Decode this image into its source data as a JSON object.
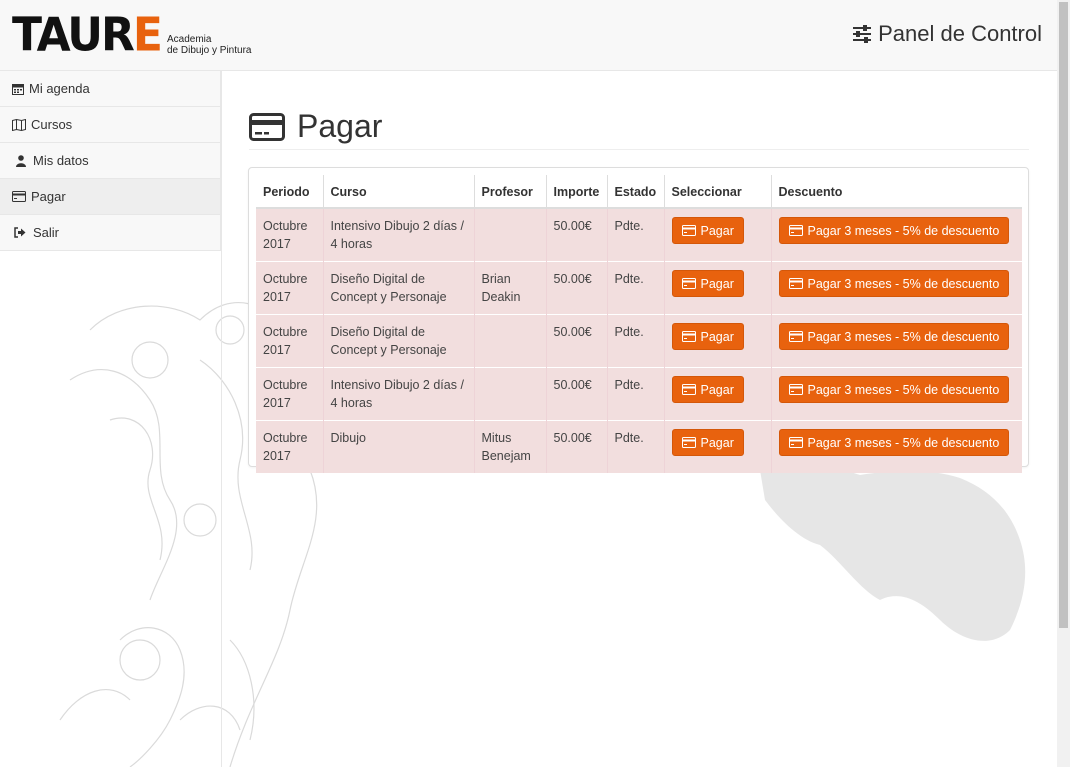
{
  "header": {
    "logo_main": "TAUR",
    "logo_accent": "E",
    "logo_sub_line1": "Academia",
    "logo_sub_line2": "de Dibujo y Pintura",
    "panel_label": "Panel de Control"
  },
  "sidebar": {
    "items": [
      {
        "label": "Mi agenda",
        "icon": "calendar-icon"
      },
      {
        "label": "Cursos",
        "icon": "map-icon"
      },
      {
        "label": "Mis datos",
        "icon": "user-icon"
      },
      {
        "label": "Pagar",
        "icon": "credit-card-icon"
      },
      {
        "label": "Salir",
        "icon": "sign-out-icon"
      }
    ]
  },
  "page": {
    "title": "Pagar",
    "title_icon": "credit-card-icon"
  },
  "table": {
    "headers": [
      "Periodo",
      "Curso",
      "Profesor",
      "Importe",
      "Estado",
      "Seleccionar",
      "Descuento"
    ],
    "pay_label": "Pagar",
    "discount_label": "Pagar 3 meses - 5% de descuento",
    "rows": [
      {
        "periodo": "Octubre 2017",
        "curso": "Intensivo Dibujo 2 días / 4 horas",
        "profesor": "",
        "importe": "50.00€",
        "estado": "Pdte."
      },
      {
        "periodo": "Octubre 2017",
        "curso": "Diseño Digital de Concept y Personaje",
        "profesor": "Brian Deakin",
        "importe": "50.00€",
        "estado": "Pdte."
      },
      {
        "periodo": "Octubre 2017",
        "curso": "Diseño Digital de Concept y Personaje",
        "profesor": "",
        "importe": "50.00€",
        "estado": "Pdte."
      },
      {
        "periodo": "Octubre 2017",
        "curso": "Intensivo Dibujo 2 días / 4 horas",
        "profesor": "",
        "importe": "50.00€",
        "estado": "Pdte."
      },
      {
        "periodo": "Octubre 2017",
        "curso": "Dibujo",
        "profesor": "Mitus Benejam",
        "importe": "50.00€",
        "estado": "Pdte."
      }
    ]
  },
  "colors": {
    "accent": "#e8620e",
    "row_danger": "#f2dede"
  }
}
